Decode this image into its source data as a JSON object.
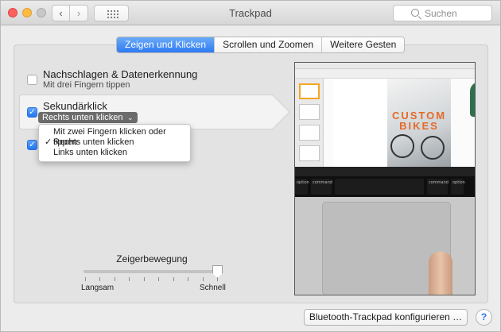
{
  "window": {
    "title": "Trackpad"
  },
  "search": {
    "placeholder": "Suchen"
  },
  "tabs": [
    {
      "label": "Zeigen und Klicken",
      "active": true
    },
    {
      "label": "Scrollen und Zoomen",
      "active": false
    },
    {
      "label": "Weitere Gesten",
      "active": false
    }
  ],
  "options": {
    "lookup": {
      "title": "Nachschlagen & Datenerkennung",
      "subtitle": "Mit drei Fingern tippen",
      "checked": false
    },
    "secondary_click": {
      "title": "Sekundärklick",
      "selected": "Rechts unten klicken",
      "checked": true
    },
    "tap_to_click": {
      "checked": true
    }
  },
  "dropdown": {
    "items": [
      {
        "label": "Mit zwei Fingern klicken oder tippen",
        "checked": false
      },
      {
        "label": "Rechts unten klicken",
        "checked": true
      },
      {
        "label": "Links unten klicken",
        "checked": false
      }
    ]
  },
  "tracking_speed": {
    "title": "Zeigerbewegung",
    "min_label": "Langsam",
    "max_label": "Schnell",
    "value": 1.0
  },
  "preview": {
    "headline": "CUSTOM BIKES",
    "keys": {
      "option": "option",
      "command": "command"
    }
  },
  "footer": {
    "bluetooth_button": "Bluetooth-Trackpad konfigurieren …",
    "help_label": "?"
  },
  "colors": {
    "accent": "#2e7af4",
    "popup_bg": "#6c6c6c"
  }
}
